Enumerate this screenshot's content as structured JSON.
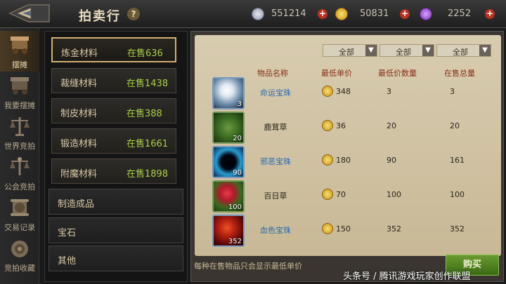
{
  "header": {
    "title": "拍卖行",
    "help": "?"
  },
  "currencies": [
    {
      "icon": "silver-gem-icon",
      "value": "551214"
    },
    {
      "icon": "gold-coin-icon",
      "value": "50831"
    },
    {
      "icon": "purple-crystal-icon",
      "value": "2252"
    }
  ],
  "nav": [
    {
      "label": "摆摊",
      "icon": "stall-cart-icon"
    },
    {
      "label": "我要摆摊",
      "icon": "cart-icon"
    },
    {
      "label": "世界竞拍",
      "icon": "scales-icon"
    },
    {
      "label": "公会竞拍",
      "icon": "guild-scales-icon"
    },
    {
      "label": "交易记录",
      "icon": "scroll-icon"
    },
    {
      "label": "竞拍收藏",
      "icon": "coin-bag-icon"
    }
  ],
  "categories": {
    "sub": [
      {
        "name": "炼金材料",
        "count": "在售636"
      },
      {
        "name": "裁缝材料",
        "count": "在售1438"
      },
      {
        "name": "制皮材料",
        "count": "在售388"
      },
      {
        "name": "锻造材料",
        "count": "在售1661"
      },
      {
        "name": "附魔材料",
        "count": "在售1898"
      }
    ],
    "main": [
      "制造成品",
      "宝石",
      "其他"
    ]
  },
  "filters": [
    "全部",
    "全部",
    "全部"
  ],
  "table": {
    "headers": [
      "物品名称",
      "最低单价",
      "最低价数量",
      "在售总量"
    ],
    "rows": [
      {
        "name": "命运宝珠",
        "qty": "3",
        "price": "348",
        "count": "3",
        "total": "3",
        "name_color": "#2a6ab0"
      },
      {
        "name": "鹿茸草",
        "qty": "20",
        "price": "36",
        "count": "20",
        "total": "20",
        "name_color": "#2a2418"
      },
      {
        "name": "邪恶宝珠",
        "qty": "90",
        "price": "180",
        "count": "90",
        "total": "161",
        "name_color": "#2a6ab0"
      },
      {
        "name": "百日草",
        "qty": "100",
        "price": "70",
        "count": "100",
        "total": "100",
        "name_color": "#2a2418"
      },
      {
        "name": "血色宝珠",
        "qty": "352",
        "price": "150",
        "count": "352",
        "total": "352",
        "name_color": "#2a6ab0"
      }
    ]
  },
  "footer": {
    "note": "每种在售物品只会显示最低单价",
    "buy_label": "购买"
  },
  "watermark": "头条号 / 腾讯游戏玩家创作联盟"
}
